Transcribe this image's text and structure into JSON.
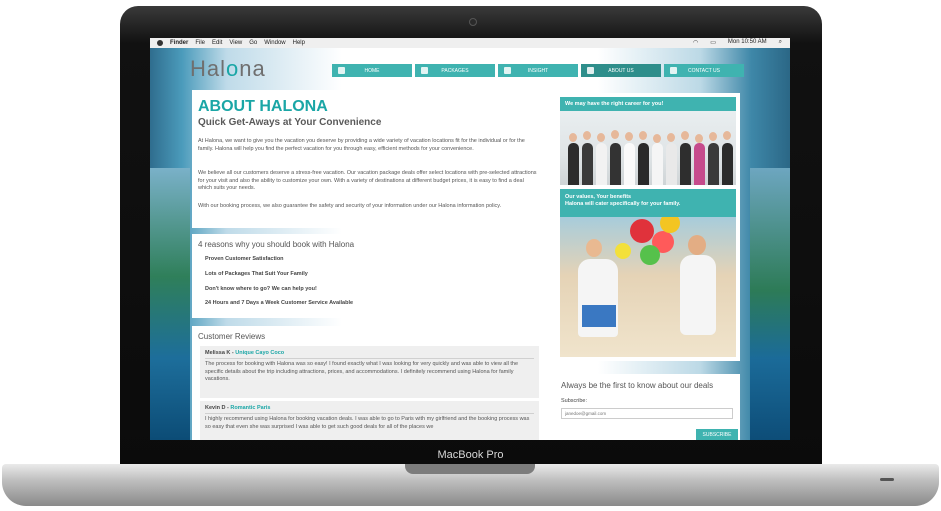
{
  "device": {
    "brand": "MacBook Pro"
  },
  "menubar": {
    "items": [
      "Finder",
      "File",
      "Edit",
      "View",
      "Go",
      "Window",
      "Help"
    ],
    "clock": "Mon 10:50 AM"
  },
  "site": {
    "logo_prefix": "Hal",
    "logo_mid": "o",
    "logo_suffix": "na",
    "nav": [
      {
        "label": "HOME",
        "icon": "home-icon"
      },
      {
        "label": "PACKAGES",
        "icon": "palm-icon"
      },
      {
        "label": "INSIGHT",
        "icon": "monitor-icon"
      },
      {
        "label": "ABOUT US",
        "icon": "person-icon"
      },
      {
        "label": "CONTACT US",
        "icon": "phone-icon"
      }
    ]
  },
  "about": {
    "title": "ABOUT HALONA",
    "subtitle": "Quick Get-Aways at Your Convenience",
    "p1": "At Halona, we want to give you the vacation you deserve by providing a wide variety of vacation locations fit for the individual or for the family. Halona will help you find the perfect vacation for you through easy, efficient methods for your convenience.",
    "p2": "We believe all our customers deserve a stress-free vacation. Our vacation package deals offer select locations with pre-selected attractions for your visit and also the ability to customize your own. With a variety of destinations at different budget prices, it is easy to find a deal which suits your needs.",
    "p3": "With our booking process, we also guarantee the safety and security of your information under our Halona information policy."
  },
  "reasons": {
    "title": "4 reasons why you should book with Halona",
    "items": [
      "Proven Customer Satisfaction",
      "Lots of Packages That Suit Your Family",
      "Don't know where to go? We can help you!",
      "24 Hours and 7 Days a Week Customer Service Available"
    ]
  },
  "reviews": {
    "title": "Customer Reviews",
    "items": [
      {
        "name": "Melissa K - ",
        "package": "Unique Cayo Coco",
        "text": "The process for booking with Halona was so easy! I found exactly what I was looking for very quickly and was able to view all the specific details about the trip including attractions, prices, and accommodations. I definitely recommend using Halona for family vacations."
      },
      {
        "name": "Kevin D - ",
        "package": "Romantic Paris",
        "text": "I highly recommend using Halona for booking vacation deals. I was able to go to Paris with my girlfriend and the booking process was so easy that even she was surprised I was able to get such good deals for all of the places we"
      }
    ]
  },
  "side": {
    "career_title": "We may have the right career for you!",
    "values_line1": "Our values, Your benefits",
    "values_line2": "Halona will cater specifically for your family."
  },
  "deals": {
    "title": "Always be the first to know about our deals",
    "subscribe_label": "Subscribe:",
    "email_placeholder": "janedoe@gmail.com",
    "button": "SUBSCRIBE"
  },
  "colors": {
    "accent": "#3fb3b0",
    "accent_dark": "#2e8e8b",
    "title": "#1aa6a6"
  }
}
